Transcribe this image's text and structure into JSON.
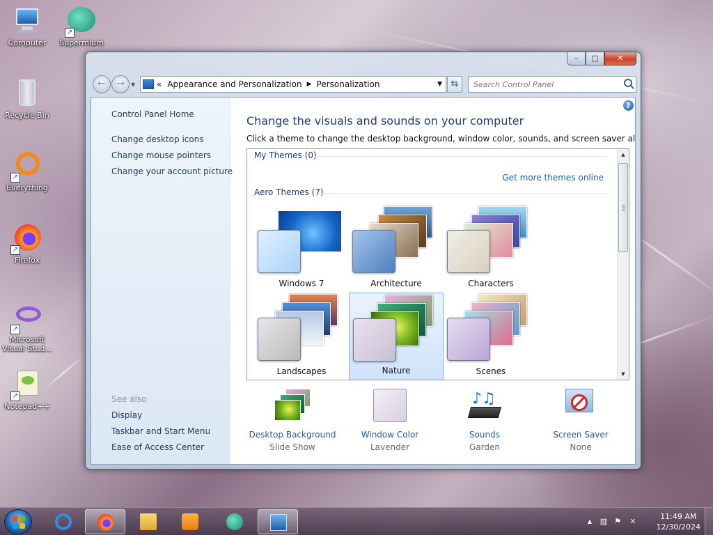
{
  "desktop": {
    "icons": [
      {
        "label": "Computer"
      },
      {
        "label": "Supermium"
      },
      {
        "label": "Recycle Bin"
      },
      {
        "label": "Everything"
      },
      {
        "label": "Firefox"
      },
      {
        "label": "Microsoft Visual Stud..."
      },
      {
        "label": "Notepad++"
      }
    ]
  },
  "window": {
    "caption": {
      "minimize": "–",
      "maximize": "□",
      "close": "✕"
    },
    "nav": {
      "back": "←",
      "forward": "→",
      "breadcrumb_prefix": "«",
      "breadcrumb": [
        "Appearance and Personalization",
        "Personalization"
      ],
      "search_placeholder": "Search Control Panel"
    },
    "left_pane": {
      "home": "Control Panel Home",
      "links": [
        "Change desktop icons",
        "Change mouse pointers",
        "Change your account picture"
      ],
      "see_also_heading": "See also",
      "see_also": [
        "Display",
        "Taskbar and Start Menu",
        "Ease of Access Center"
      ]
    },
    "main": {
      "help": "?",
      "title": "Change the visuals and sounds on your computer",
      "description": "Click a theme to change the desktop background, window color, sounds, and screen saver all at once.",
      "my_themes": "My Themes (0)",
      "get_more": "Get more themes online",
      "aero_themes": "Aero Themes (7)",
      "themes": [
        {
          "name": "Windows 7",
          "selected": false
        },
        {
          "name": "Architecture",
          "selected": false
        },
        {
          "name": "Characters",
          "selected": false
        },
        {
          "name": "Landscapes",
          "selected": false
        },
        {
          "name": "Nature",
          "selected": true
        },
        {
          "name": "Scenes",
          "selected": false
        }
      ],
      "options": [
        {
          "title": "Desktop Background",
          "value": "Slide Show",
          "icon": "desktop-background-icon"
        },
        {
          "title": "Window Color",
          "value": "Lavender",
          "icon": "window-color-icon"
        },
        {
          "title": "Sounds",
          "value": "Garden",
          "icon": "sounds-icon"
        },
        {
          "title": "Screen Saver",
          "value": "None",
          "icon": "screen-saver-icon"
        }
      ]
    }
  },
  "taskbar": {
    "buttons": [
      "Internet Explorer",
      "Firefox",
      "File Explorer",
      "Media Player",
      "Supermium",
      "Control Panel"
    ],
    "active": "Control Panel",
    "tray": {
      "show_hidden": "▲"
    },
    "clock": {
      "time": "11:49 AM",
      "date": "12/30/2024"
    }
  },
  "colors": {
    "link": "#1e5ea8",
    "title": "#1e3d7a",
    "window_color": "#e2dbe6"
  }
}
